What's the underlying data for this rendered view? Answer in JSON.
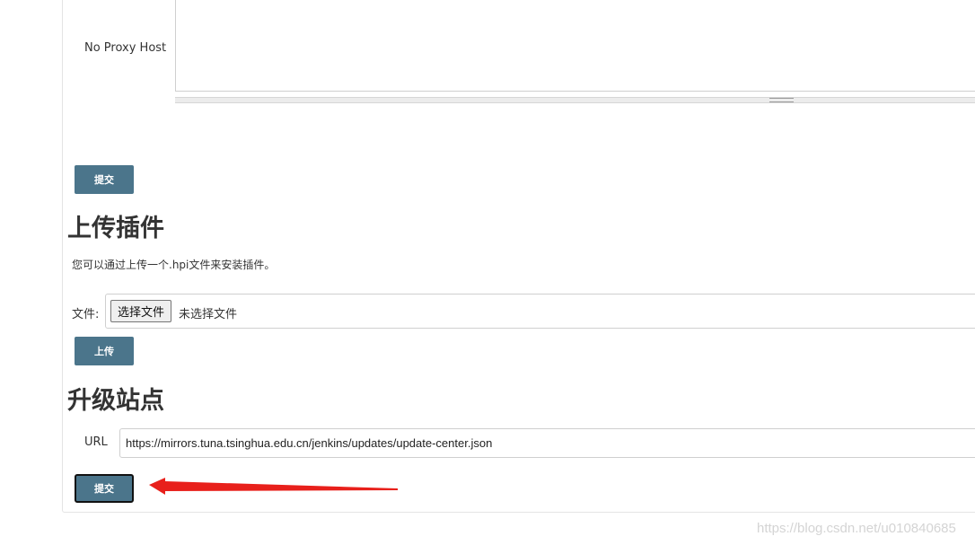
{
  "proxy": {
    "no_proxy_label": "No Proxy Host",
    "submit_label": "提交"
  },
  "upload_plugin": {
    "title": "上传插件",
    "description": "您可以通过上传一个.hpi文件来安装插件。",
    "file_label": "文件:",
    "choose_file_label": "选择文件",
    "no_file_text": "未选择文件",
    "upload_label": "上传"
  },
  "update_site": {
    "title": "升级站点",
    "url_label": "URL",
    "url_value": "https://mirrors.tuna.tsinghua.edu.cn/jenkins/updates/update-center.json",
    "submit_label": "提交"
  },
  "annotation": {
    "arrow_color": "#e8201b"
  },
  "watermark": "https://blog.csdn.net/u010840685",
  "colors": {
    "button_bg": "#4b758b",
    "border": "#cfcfcf"
  }
}
